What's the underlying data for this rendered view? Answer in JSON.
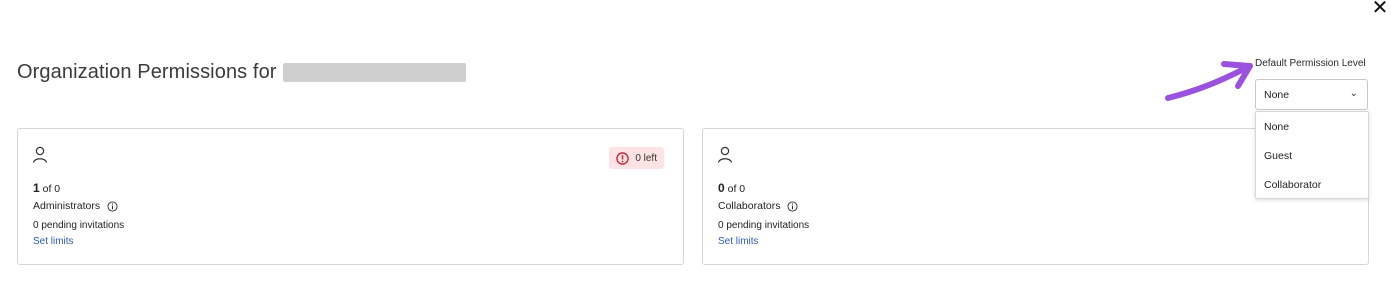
{
  "header": {
    "title": "Organization Permissions for",
    "close_symbol": "✕"
  },
  "default_permission": {
    "label": "Default Permission Level",
    "selected": "None",
    "options": [
      "None",
      "Guest",
      "Collaborator"
    ],
    "arrow_color": "#9b51e0"
  },
  "cards": [
    {
      "count": "1",
      "of_text": "of 0",
      "role": "Administrators",
      "pending": "0 pending invitations",
      "link": "Set limits",
      "badge": "0 left"
    },
    {
      "count": "0",
      "of_text": "of 0",
      "role": "Collaborators",
      "pending": "0 pending invitations",
      "link": "Set limits"
    }
  ],
  "colors": {
    "badge_bg": "#fde3e3",
    "badge_icon": "#d0182c",
    "link": "#2d5bb5"
  }
}
